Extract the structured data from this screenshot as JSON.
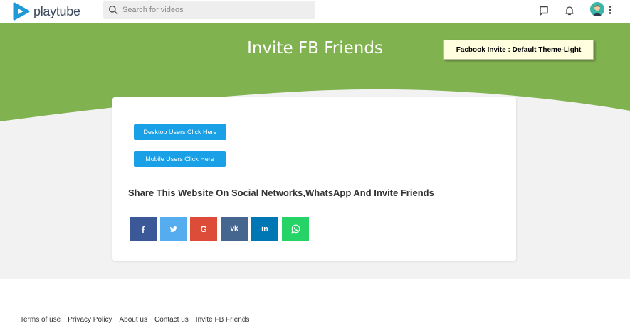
{
  "header": {
    "logo_text": "playtube",
    "search_placeholder": "Search for videos",
    "icons": [
      "messages-icon",
      "notifications-icon",
      "avatar",
      "more-vert-icon"
    ]
  },
  "hero": {
    "title": "Invite FB Friends",
    "theme_badge": "Facbook Invite : Default Theme-Light",
    "colors": {
      "green": "#81b250",
      "background": "#f2f2f2"
    }
  },
  "card": {
    "desktop_button": "Desktop Users Click Here",
    "mobile_button": "Mobile Users Click Here",
    "share_heading": "Share This Website On Social Networks,WhatsApp And Invite Friends",
    "social": [
      {
        "name": "facebook",
        "glyph": "f",
        "color": "#3b5998"
      },
      {
        "name": "twitter",
        "glyph": "t",
        "color": "#55acee"
      },
      {
        "name": "google",
        "glyph": "G",
        "color": "#dd4b39"
      },
      {
        "name": "vk",
        "glyph": "vk",
        "color": "#45668e"
      },
      {
        "name": "linkedin",
        "glyph": "in",
        "color": "#0077b5"
      },
      {
        "name": "whatsapp",
        "glyph": "wa",
        "color": "#25d366"
      }
    ],
    "button_color": "#1aa0e6"
  },
  "footer": {
    "links": [
      "Terms of use",
      "Privacy Policy",
      "About us",
      "Contact us",
      "Invite FB Friends"
    ]
  }
}
